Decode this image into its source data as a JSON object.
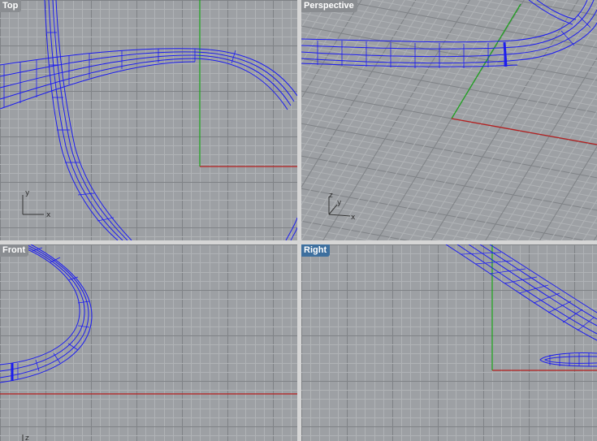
{
  "viewports": {
    "top": {
      "label": "Top",
      "active": false,
      "axes": [
        "y",
        "x"
      ]
    },
    "persp": {
      "label": "Perspective",
      "active": false,
      "axes": [
        "z",
        "y",
        "x"
      ]
    },
    "front": {
      "label": "Front",
      "active": false,
      "axes": [
        "z"
      ]
    },
    "right": {
      "label": "Right",
      "active": true,
      "axes": []
    }
  },
  "colors": {
    "background": "#9da0a4",
    "grid_minor": "#b0b3b6",
    "grid_major": "#7f8286",
    "x_axis": "#b51f1f",
    "y_axis": "#21a121",
    "curve": "#1c1cf0",
    "active_label": "#3d6f9e",
    "inactive_label": "#8a8d91"
  }
}
